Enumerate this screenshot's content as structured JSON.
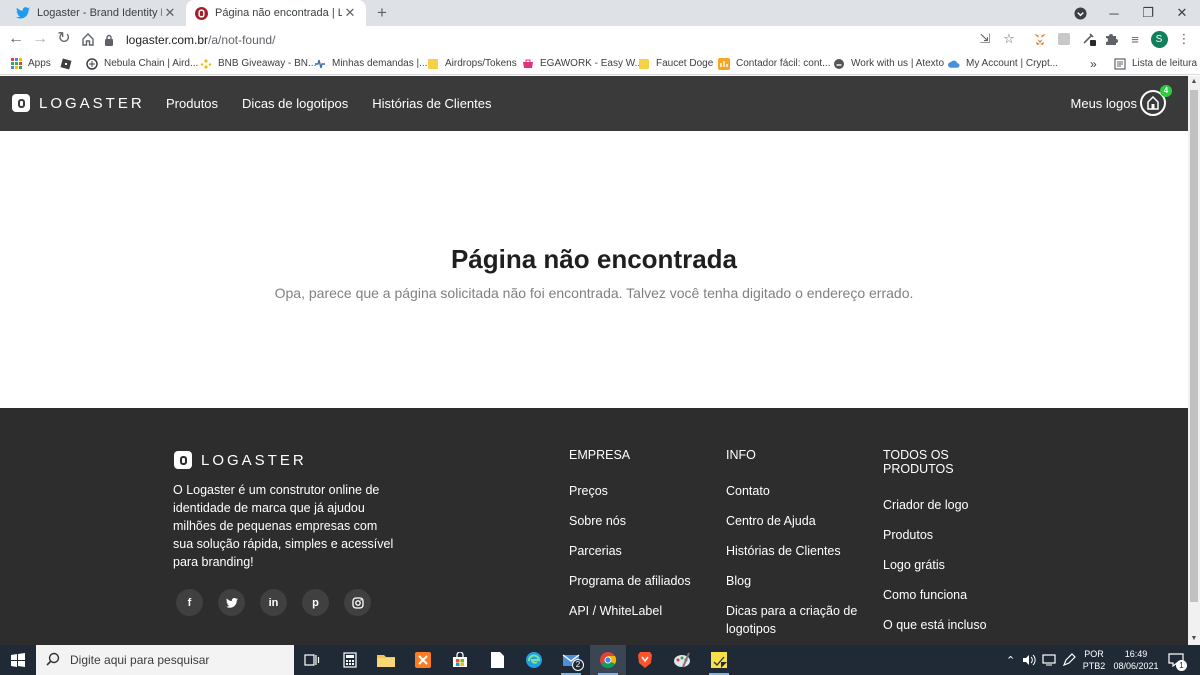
{
  "browser": {
    "tabs": [
      {
        "title": "Logaster - Brand Identity Builder",
        "icon": "twitter-icon",
        "active": false
      },
      {
        "title": "Página não encontrada | Logaster",
        "icon": "logaster-icon",
        "active": true
      }
    ],
    "address": {
      "domain": "logaster.com.br",
      "path": "/a/not-found/"
    },
    "profile_initial": "S",
    "bookmarks": [
      {
        "label": "Apps",
        "icon": "apps-grid-icon"
      },
      {
        "label": "",
        "icon": "roblox-icon"
      },
      {
        "label": "Nebula Chain | Aird...",
        "icon": "nebula-icon"
      },
      {
        "label": "BNB Giveaway - BN...",
        "icon": "binance-icon"
      },
      {
        "label": "Minhas demandas |...",
        "icon": "demands-icon"
      },
      {
        "label": "Airdrops/Tokens",
        "icon": "folder-icon"
      },
      {
        "label": "EGAWORK - Easy W...",
        "icon": "egawork-icon"
      },
      {
        "label": "Faucet Doge",
        "icon": "folder-icon"
      },
      {
        "label": "Contador fácil: cont...",
        "icon": "contador-icon"
      },
      {
        "label": "Work with us | Atexto",
        "icon": "atexto-icon"
      },
      {
        "label": "My Account | Crypt...",
        "icon": "cloud-icon"
      }
    ],
    "more_bookmarks": "»",
    "reading_list": "Lista de leitura"
  },
  "site": {
    "brand": "LOGASTER",
    "nav": [
      "Produtos",
      "Dicas de logotipos",
      "Histórias de Clientes"
    ],
    "my_logos": "Meus logos",
    "my_logos_count": "4"
  },
  "main": {
    "title": "Página não encontrada",
    "subtitle": "Opa, parece que a página solicitada não foi encontrada. Talvez você tenha digitado o endereço errado."
  },
  "footer": {
    "brand": "LOGASTER",
    "about": "O Logaster é um construtor online de identidade de marca que já ajudou milhões de pequenas empresas com sua solução rápida, simples e acessível para branding!",
    "socials": [
      {
        "name": "facebook",
        "glyph": "f"
      },
      {
        "name": "twitter",
        "glyph": "t"
      },
      {
        "name": "linkedin",
        "glyph": "in"
      },
      {
        "name": "pinterest",
        "glyph": "p"
      },
      {
        "name": "instagram",
        "glyph": "◎"
      }
    ],
    "columns": [
      {
        "title": "EMPRESA",
        "items": [
          "Preços",
          "Sobre nós",
          "Parcerias",
          "Programa de afiliados",
          "API / WhiteLabel"
        ]
      },
      {
        "title": "INFO",
        "items": [
          "Contato",
          "Centro de Ajuda",
          "Histórias de Clientes",
          "Blog",
          "Dicas para a criação de logotipos"
        ]
      },
      {
        "title": "TODOS OS PRODUTOS",
        "items": [
          "Criador de logo",
          "Produtos",
          "Logo grátis",
          "Como funciona",
          "O que está incluso"
        ]
      }
    ]
  },
  "taskbar": {
    "search_placeholder": "Digite aqui para pesquisar",
    "mail_badge": "2",
    "language": "POR",
    "layout": "PTB2",
    "time": "16:49",
    "date": "08/06/2021",
    "notification_count": "1"
  },
  "colors": {
    "header_bg": "#3a3a3a",
    "footer_bg": "#2d2d2d",
    "badge_green": "#2ecc40",
    "taskbar_bg": "#1f2a36"
  }
}
